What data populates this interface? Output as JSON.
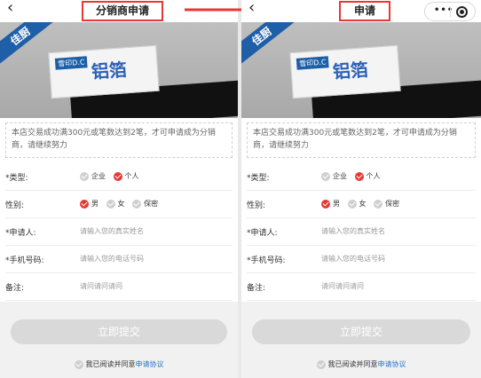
{
  "left": {
    "title": "分销商申请",
    "banner_corner": "佳厨",
    "product_brand": "雪印D.C",
    "product_name": "铝箔",
    "notice": "本店交易成功满300元或笔数达到2笔，才可申请成为分销商，请继续努力",
    "form": {
      "type_label": "*类型:",
      "type_options": [
        "企业",
        "个人"
      ],
      "gender_label": "性别:",
      "gender_options": [
        "男",
        "女",
        "保密"
      ],
      "applicant_label": "*申请人:",
      "applicant_placeholder": "请输入您的真实姓名",
      "phone_label": "*手机号码:",
      "phone_placeholder": "请输入您的电话号码",
      "remark_label": "备注:",
      "remark_value": "请问请问请问"
    },
    "submit_label": "立即提交",
    "agree_text": "我已阅读并同意",
    "agree_link": "申请协议"
  },
  "right": {
    "title": "申请",
    "banner_corner": "佳厨",
    "product_brand": "雪印D.C",
    "product_name": "铝箔",
    "notice": "本店交易成功满300元或笔数达到2笔，才可申请成为分销商，请继续努力",
    "form": {
      "type_label": "*类型:",
      "type_options": [
        "企业",
        "个人"
      ],
      "gender_label": "性别:",
      "gender_options": [
        "男",
        "女",
        "保密"
      ],
      "applicant_label": "*申请人:",
      "applicant_placeholder": "请输入您的真实姓名",
      "phone_label": "*手机号码:",
      "phone_placeholder": "请输入您的电话号码",
      "remark_label": "备注:",
      "remark_value": "请问请问请问"
    },
    "submit_label": "立即提交",
    "agree_text": "我已阅读并同意",
    "agree_link": "申请协议"
  },
  "colors": {
    "accent": "#e53935",
    "link": "#2b72c6",
    "banner_blue": "#1f5fa8"
  }
}
